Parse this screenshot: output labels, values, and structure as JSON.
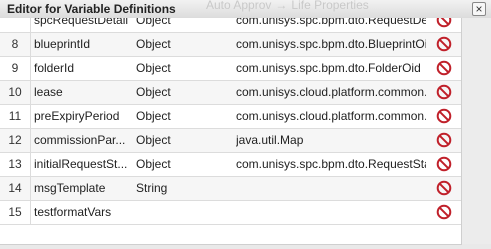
{
  "window": {
    "title": "Editor for Variable Definitions",
    "background_tabs": [
      "Auto Approv",
      "Life Properties"
    ],
    "close_label": "×"
  },
  "columns_note": "",
  "rows": [
    {
      "index": "",
      "name": "spcRequestDetail",
      "type": "Object",
      "class": "com.unisys.spc.bpm.dto.RequestDet..."
    },
    {
      "index": "8",
      "name": "blueprintId",
      "type": "Object",
      "class": "com.unisys.spc.bpm.dto.BlueprintOid"
    },
    {
      "index": "9",
      "name": "folderId",
      "type": "Object",
      "class": "com.unisys.spc.bpm.dto.FolderOid"
    },
    {
      "index": "10",
      "name": "lease",
      "type": "Object",
      "class": "com.unisys.cloud.platform.common...."
    },
    {
      "index": "11",
      "name": "preExpiryPeriod",
      "type": "Object",
      "class": "com.unisys.cloud.platform.common...."
    },
    {
      "index": "12",
      "name": "commissionPar...",
      "type": "Object",
      "class": "java.util.Map"
    },
    {
      "index": "13",
      "name": "initialRequestSt...",
      "type": "Object",
      "class": "com.unisys.spc.bpm.dto.RequestSta..."
    },
    {
      "index": "14",
      "name": "msgTemplate",
      "type": "String",
      "class": ""
    },
    {
      "index": "15",
      "name": "testformatVars",
      "type": "",
      "class": ""
    }
  ],
  "icons": {
    "delete": "delete-prohibited-icon"
  },
  "colors": {
    "delete_red": "#c0202a"
  }
}
